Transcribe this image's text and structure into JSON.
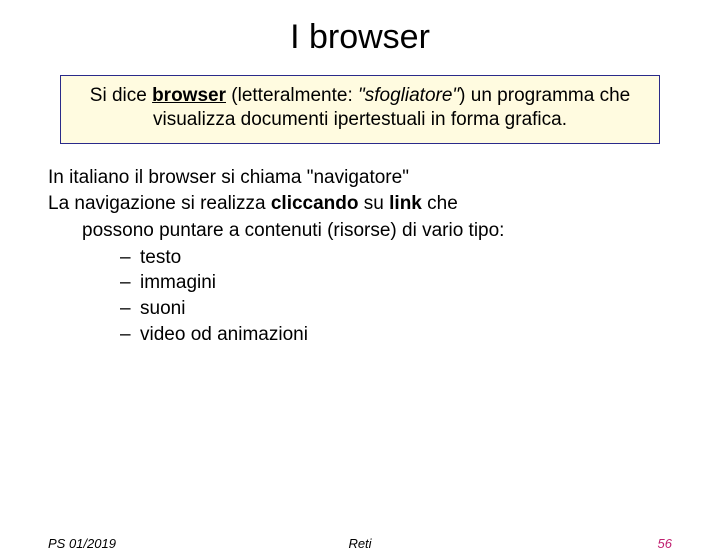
{
  "title": "I browser",
  "box": {
    "pre": "Si dice ",
    "term": "browser",
    "mid1": " (letteralmente: ",
    "ital": "\"sfogliatore\"",
    "mid2": ") un programma che visualizza documenti ipertestuali in forma grafica."
  },
  "para1": "In italiano il browser si chiama \"navigatore\"",
  "para2": {
    "a": "La navigazione si realizza ",
    "b": "cliccando",
    "c": " su ",
    "d": "link",
    "e": " che",
    "f": "possono puntare a contenuti (risorse) di vario tipo:"
  },
  "items": {
    "i0": "testo",
    "i1": "immagini",
    "i2": "suoni",
    "i3": "video od animazioni"
  },
  "footer": {
    "left": "PS 01/2019",
    "center": "Reti",
    "right": "56"
  }
}
